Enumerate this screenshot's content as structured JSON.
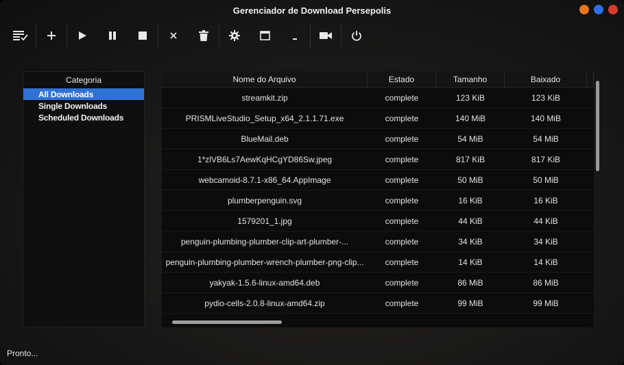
{
  "window": {
    "title": "Gerenciador de Download Persepolis",
    "buttons": [
      {
        "name": "minimize",
        "color": "#e8761a"
      },
      {
        "name": "maximize",
        "color": "#2e6ee6"
      },
      {
        "name": "close",
        "color": "#d93a2a"
      }
    ]
  },
  "toolbar": {
    "items": [
      {
        "name": "queue-list-icon",
        "symbol": "list-check"
      },
      {
        "name": "add-icon",
        "symbol": "+"
      },
      {
        "name": "resume-icon",
        "symbol": "play"
      },
      {
        "name": "pause-icon",
        "symbol": "pause"
      },
      {
        "name": "stop-icon",
        "symbol": "stop"
      },
      {
        "name": "remove-icon",
        "symbol": "×"
      },
      {
        "name": "delete-icon",
        "symbol": "trash"
      },
      {
        "name": "settings-icon",
        "symbol": "gear"
      },
      {
        "name": "minimize-to-tray-icon",
        "symbol": "window"
      },
      {
        "name": "move-down-icon",
        "symbol": "-"
      },
      {
        "name": "video-finder-icon",
        "symbol": "camera"
      },
      {
        "name": "power-icon",
        "symbol": "power"
      }
    ]
  },
  "categories": {
    "header": "Categoria",
    "items": [
      {
        "label": "All Downloads",
        "selected": true
      },
      {
        "label": "Single Downloads",
        "selected": false
      },
      {
        "label": "Scheduled Downloads",
        "selected": false
      }
    ]
  },
  "table": {
    "columns": [
      "Nome do Arquivo",
      "Estado",
      "Tamanho",
      "Baixado"
    ],
    "rows": [
      [
        "streamkit.zip",
        "complete",
        "123 KiB",
        "123 KiB"
      ],
      [
        "PRISMLiveStudio_Setup_x64_2.1.1.71.exe",
        "complete",
        "140 MiB",
        "140 MiB"
      ],
      [
        "BlueMail.deb",
        "complete",
        "54 MiB",
        "54 MiB"
      ],
      [
        "1*zlVB6Ls7AewKqHCgYD86Sw.jpeg",
        "complete",
        "817 KiB",
        "817 KiB"
      ],
      [
        "webcamoid-8.7.1-x86_64.AppImage",
        "complete",
        "50 MiB",
        "50 MiB"
      ],
      [
        "plumberpenguin.svg",
        "complete",
        "16 KiB",
        "16 KiB"
      ],
      [
        "1579201_1.jpg",
        "complete",
        "44 KiB",
        "44 KiB"
      ],
      [
        "penguin-plumbing-plumber-clip-art-plumber-...",
        "complete",
        "34 KiB",
        "34 KiB"
      ],
      [
        "penguin-plumbing-plumber-wrench-plumber-png-clip...",
        "complete",
        "14 KiB",
        "14 KiB"
      ],
      [
        "yakyak-1.5.6-linux-amd64.deb",
        "complete",
        "86 MiB",
        "86 MiB"
      ],
      [
        "pydio-cells-2.0.8-linux-amd64.zip",
        "complete",
        "99 MiB",
        "99 MiB"
      ]
    ]
  },
  "status": {
    "text": "Pronto..."
  }
}
